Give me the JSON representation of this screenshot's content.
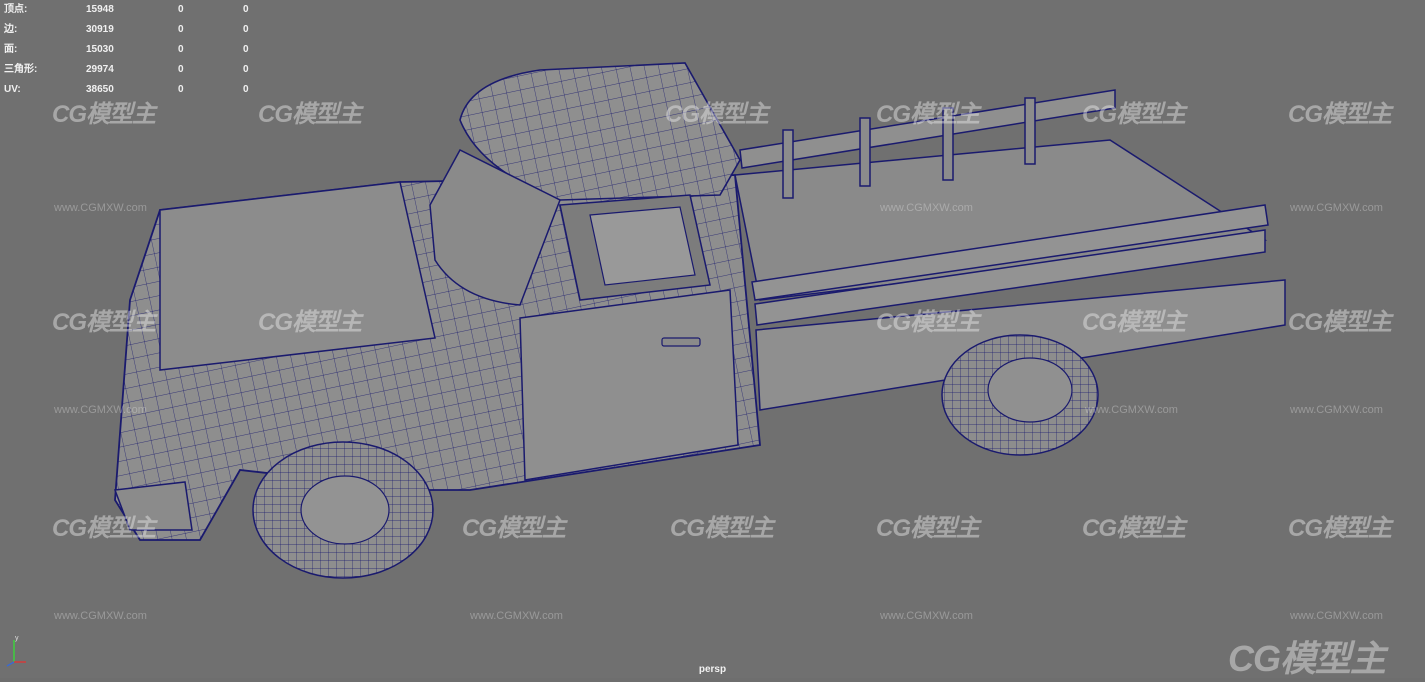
{
  "hud": {
    "rows": [
      {
        "label": "顶点:",
        "v1": "15948",
        "v2": "0",
        "v3": "0"
      },
      {
        "label": "边:",
        "v1": "30919",
        "v2": "0",
        "v3": "0"
      },
      {
        "label": "面:",
        "v1": "15030",
        "v2": "0",
        "v3": "0"
      },
      {
        "label": "三角形:",
        "v1": "29974",
        "v2": "0",
        "v3": "0"
      },
      {
        "label": "UV:",
        "v1": "38650",
        "v2": "0",
        "v3": "0"
      }
    ]
  },
  "camera": "persp",
  "watermark": {
    "logo": "CG模型主",
    "url": "www.CGMXW.com"
  },
  "colors": {
    "viewport_bg": "#707070",
    "wire": "#1a1a6e",
    "surface": "#8e8e8e"
  }
}
